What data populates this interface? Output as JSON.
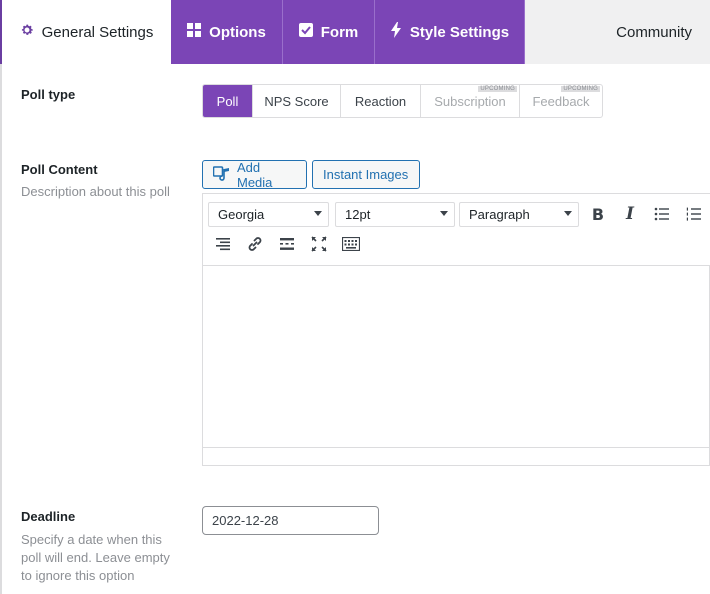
{
  "tabs": {
    "general": "General Settings",
    "options": "Options",
    "form": "Form",
    "style": "Style Settings",
    "community": "Community"
  },
  "poll_type": {
    "label": "Poll type",
    "options": [
      "Poll",
      "NPS Score",
      "Reaction",
      "Subscription",
      "Feedback"
    ],
    "selected": "Poll",
    "badge": "UPCOMING"
  },
  "poll_content": {
    "label": "Poll Content",
    "description": "Description about this poll",
    "add_media": "Add Media",
    "instant_images": "Instant Images",
    "font_family": "Georgia",
    "font_size": "12pt",
    "block_format": "Paragraph"
  },
  "deadline": {
    "label": "Deadline",
    "description_lines": [
      "Specify a date when this",
      "poll will end. Leave empty",
      "to ignore this option"
    ],
    "value": "2022-12-28"
  },
  "colors": {
    "accent": "#7b45b6",
    "link": "#2271b1"
  }
}
